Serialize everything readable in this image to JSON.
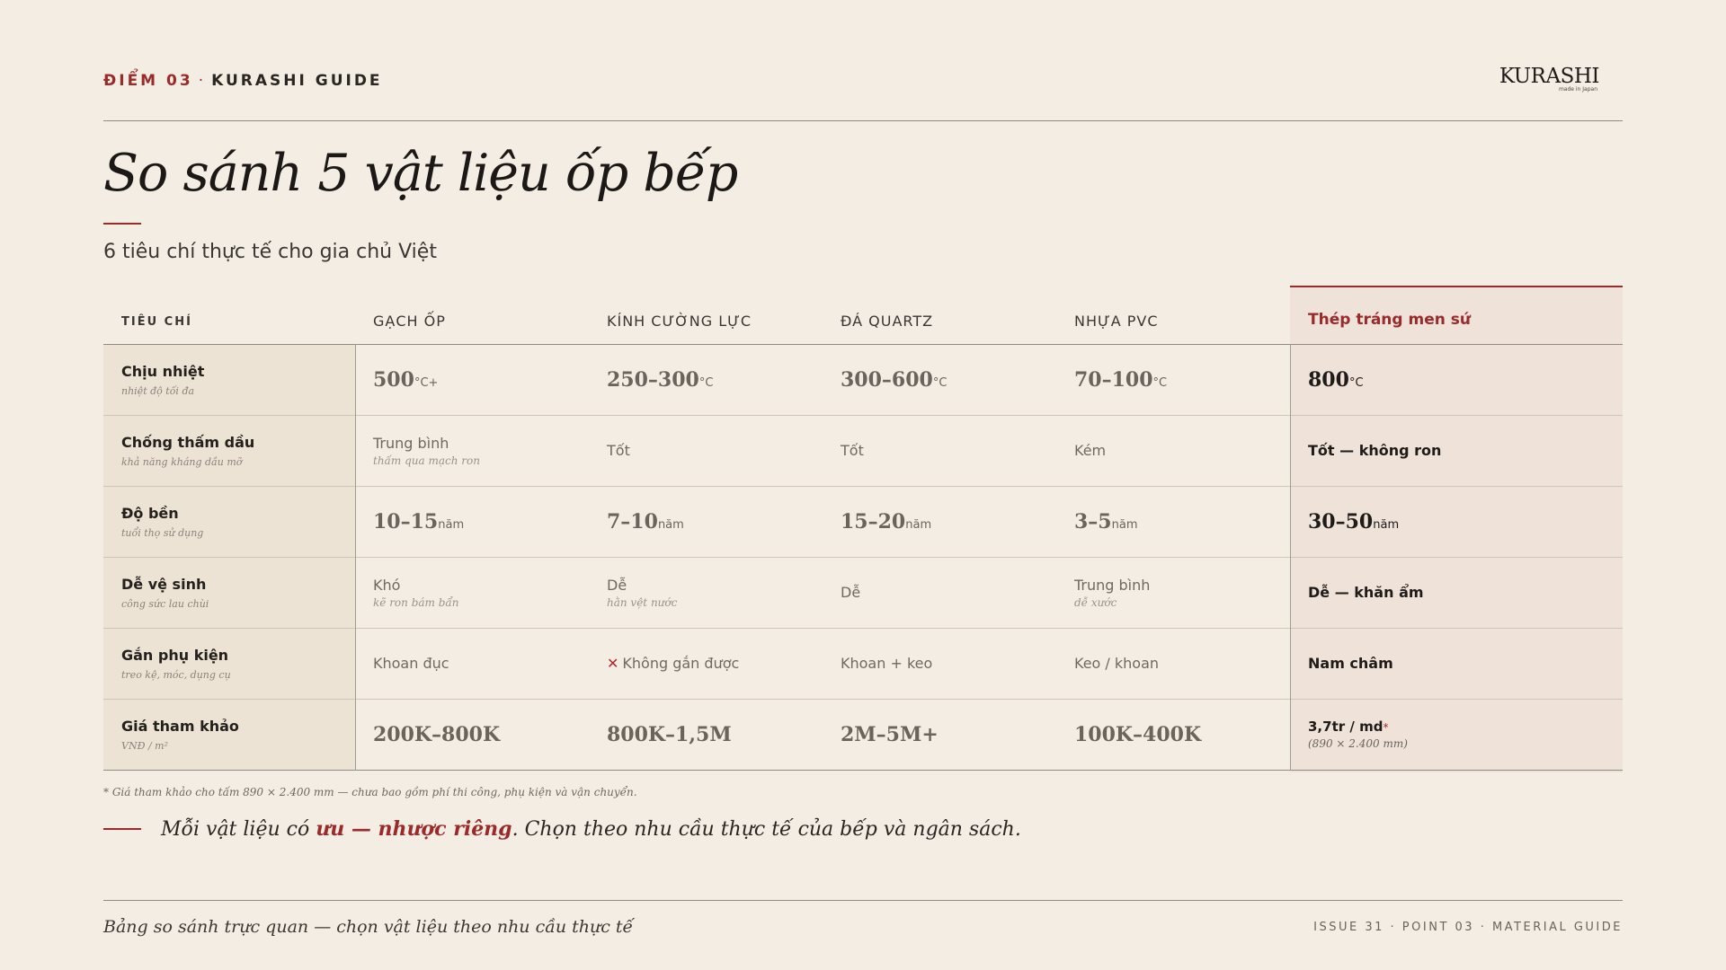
{
  "header": {
    "kicker_accent": "ĐIỂM 03",
    "kicker_sep": "·",
    "kicker_label": "KURASHI GUIDE",
    "logo_text": "KURASHI",
    "logo_sub": "made in Japan"
  },
  "title": "So sánh 5 vật liệu ốp bếp",
  "subtitle": "6 tiêu chí thực tế cho gia chủ Việt",
  "table": {
    "headers": {
      "criteria": "TIÊU CHÍ",
      "col1": "GẠCH ỐP",
      "col2": "KÍNH CƯỜNG LỰC",
      "col3": "ĐÁ QUARTZ",
      "col4": "NHỰA PVC",
      "col5": "Thép tráng men sứ"
    },
    "rows": [
      {
        "name": "Chịu nhiệt",
        "sub": "nhiệt độ tối đa",
        "c1": {
          "main": "500",
          "unit": "°C+"
        },
        "c2": {
          "main": "250–300",
          "unit": "°C"
        },
        "c3": {
          "main": "300–600",
          "unit": "°C"
        },
        "c4": {
          "main": "70–100",
          "unit": "°C"
        },
        "c5": {
          "main": "800",
          "unit": "°C"
        }
      },
      {
        "name": "Chống thấm dầu",
        "sub": "khả năng kháng dầu mỡ",
        "c1": {
          "main": "Trung bình",
          "note": "thấm qua mạch ron"
        },
        "c2": {
          "main": "Tốt"
        },
        "c3": {
          "main": "Tốt"
        },
        "c4": {
          "main": "Kém"
        },
        "c5": {
          "main": "Tốt — không ron"
        }
      },
      {
        "name": "Độ bền",
        "sub": "tuổi thọ sử dụng",
        "c1": {
          "main": "10–15",
          "unit": "năm"
        },
        "c2": {
          "main": "7–10",
          "unit": "năm"
        },
        "c3": {
          "main": "15–20",
          "unit": "năm"
        },
        "c4": {
          "main": "3–5",
          "unit": "năm"
        },
        "c5": {
          "main": "30–50",
          "unit": "năm"
        }
      },
      {
        "name": "Dễ vệ sinh",
        "sub": "công sức lau chùi",
        "c1": {
          "main": "Khó",
          "note": "kẽ ron bám bẩn"
        },
        "c2": {
          "main": "Dễ",
          "note": "hằn vệt nước"
        },
        "c3": {
          "main": "Dễ"
        },
        "c4": {
          "main": "Trung bình",
          "note": "dễ xước"
        },
        "c5": {
          "main": "Dễ — khăn ẩm"
        }
      },
      {
        "name": "Gắn phụ kiện",
        "sub": "treo kệ, móc, dụng cụ",
        "c1": {
          "main": "Khoan đục"
        },
        "c2": {
          "main": "Không gắn được",
          "icon": "x-icon"
        },
        "c3": {
          "main": "Khoan + keo"
        },
        "c4": {
          "main": "Keo / khoan"
        },
        "c5": {
          "main": "Nam châm"
        }
      },
      {
        "name": "Giá tham khảo",
        "sub": "VNĐ / m²",
        "c1": {
          "main": "200K–800K"
        },
        "c2": {
          "main": "800K–1,5M"
        },
        "c3": {
          "main": "2M–5M+"
        },
        "c4": {
          "main": "100K–400K"
        },
        "c5": {
          "main": "3,7tr / md",
          "star": "*",
          "note": "(890 × 2.400 mm)"
        }
      }
    ]
  },
  "footnote": "* Giá tham khảo cho tấm 890 × 2.400 mm — chưa bao gồm phí thi công, phụ kiện và vận chuyển.",
  "quote": {
    "before": "Mỗi vật liệu có ",
    "emphasis": "ưu — nhược riêng",
    "after": ". Chọn theo nhu cầu thực tế của bếp và ngân sách."
  },
  "footer": {
    "left": "Bảng so sánh trực quan — chọn vật liệu theo nhu cầu thực tế",
    "right": "ISSUE 31 · POINT 03 · MATERIAL GUIDE"
  },
  "colors": {
    "background": "#f3ede3",
    "accent": "#9b2a2a",
    "criteria_bg": "#ece3d4",
    "highlight_bg": "#eee2d9"
  }
}
